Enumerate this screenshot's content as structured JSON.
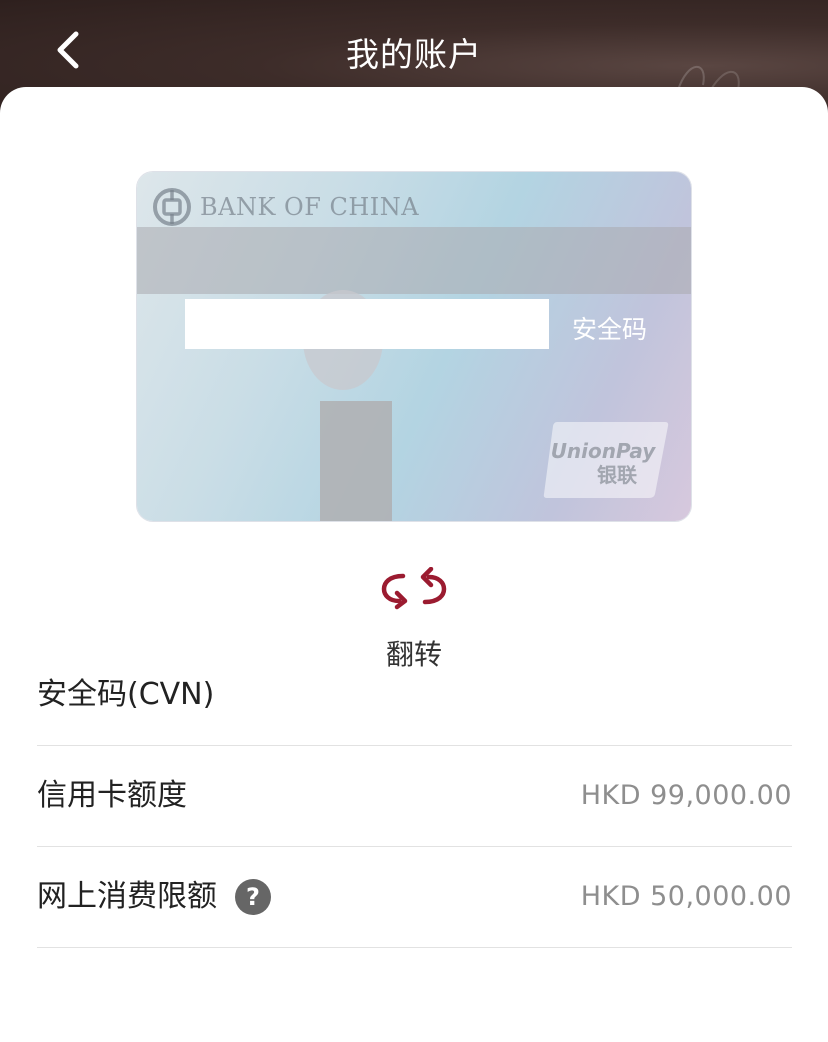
{
  "header": {
    "title": "我的账户",
    "back_icon": "chevron-left-icon"
  },
  "card": {
    "bank_name": "BANK OF CHINA",
    "security_code_label": "安全码",
    "network_logo_text": "UnionPay 银联",
    "accent_color": "#9b1b30"
  },
  "flip": {
    "label": "翻转",
    "icon": "flip-arrows-icon"
  },
  "details": {
    "rows": [
      {
        "label": "安全码(CVN)",
        "value": ""
      },
      {
        "label": "信用卡额度",
        "value": "HKD 99,000.00"
      },
      {
        "label": "网上消费限额",
        "value": "HKD 50,000.00",
        "help_icon": "?"
      }
    ]
  }
}
